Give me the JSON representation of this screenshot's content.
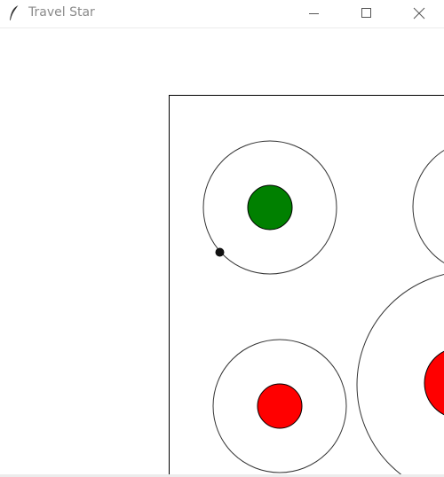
{
  "window": {
    "title": "Travel Star",
    "app_icon": "feather-icon",
    "controls": [
      "minimize-icon",
      "maximize-icon",
      "close-icon"
    ]
  },
  "colors": {
    "home_planet": "#008000",
    "target_planet": "#ff0000",
    "ship": "#111111",
    "orbit": "#333333",
    "border": "#000000"
  }
}
